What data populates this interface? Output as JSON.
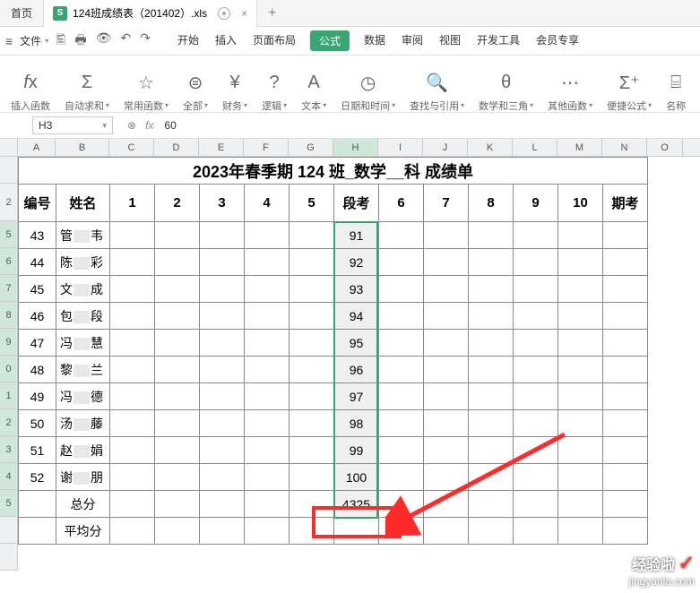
{
  "titlebar": {
    "home": "首页",
    "filename": "124班成绩表（201402）.xls",
    "plus": "+"
  },
  "menubar": {
    "file": "文件",
    "tabs": [
      "开始",
      "插入",
      "页面布局",
      "公式",
      "数据",
      "审阅",
      "视图",
      "开发工具",
      "会员专享"
    ]
  },
  "ribbon": {
    "items": [
      {
        "icon": "fx",
        "label": "插入函数"
      },
      {
        "icon": "Σ",
        "label": "自动求和"
      },
      {
        "icon": "☆",
        "label": "常用函数"
      },
      {
        "icon": "⊜",
        "label": "全部"
      },
      {
        "icon": "￥",
        "label": "财务"
      },
      {
        "icon": "?",
        "label": "逻辑"
      },
      {
        "icon": "A",
        "label": "文本"
      },
      {
        "icon": "⊙",
        "label": "日期和时间"
      },
      {
        "icon": "Q",
        "label": "查找与引用"
      },
      {
        "icon": "e",
        "label": "数学和三角"
      },
      {
        "icon": "…",
        "label": "其他函数"
      },
      {
        "icon": "Σ₊",
        "label": "便捷公式"
      },
      {
        "icon": "",
        "label": "名称"
      }
    ]
  },
  "formula_bar": {
    "name_box": "H3",
    "fx": "fx",
    "value": "60"
  },
  "columns": [
    "A",
    "B",
    "C",
    "D",
    "E",
    "F",
    "G",
    "H",
    "I",
    "J",
    "K",
    "L",
    "M",
    "N",
    "O"
  ],
  "row_numbers_visible": [
    "",
    "2",
    "5",
    "6",
    "7",
    "8",
    "9",
    "0",
    "1",
    "2",
    "3",
    "4",
    "5",
    "",
    ""
  ],
  "active_col": "H",
  "sheet": {
    "title": "2023年春季期 124 班_数学__科 成绩单",
    "headers": {
      "bianhao": "编号",
      "xingming": "姓名",
      "c1": "1",
      "c2": "2",
      "c3": "3",
      "c4": "4",
      "c5": "5",
      "duankao": "段考",
      "c6": "6",
      "c7": "7",
      "c8": "8",
      "c9": "9",
      "c10": "10",
      "qikao": "期考"
    },
    "rows": [
      {
        "id": "43",
        "name_first": "管",
        "name_last": "韦",
        "duankao": "91"
      },
      {
        "id": "44",
        "name_first": "陈",
        "name_last": "彩",
        "duankao": "92"
      },
      {
        "id": "45",
        "name_first": "文",
        "name_last": "成",
        "duankao": "93"
      },
      {
        "id": "46",
        "name_first": "包",
        "name_last": "段",
        "duankao": "94"
      },
      {
        "id": "47",
        "name_first": "冯",
        "name_last": "慧",
        "duankao": "95"
      },
      {
        "id": "48",
        "name_first": "黎",
        "name_last": "兰",
        "duankao": "96"
      },
      {
        "id": "49",
        "name_first": "冯",
        "name_last": "德",
        "duankao": "97"
      },
      {
        "id": "50",
        "name_first": "汤",
        "name_last": "藤",
        "duankao": "98"
      },
      {
        "id": "51",
        "name_first": "赵",
        "name_last": "娟",
        "duankao": "99"
      },
      {
        "id": "52",
        "name_first": "谢",
        "name_last": "朋",
        "duankao": "100"
      }
    ],
    "total_label": "总分",
    "total_value": "4325",
    "avg_label": "平均分"
  },
  "watermark": {
    "line1": "经验啦",
    "check": "✓",
    "line2": "jingyanla.com"
  }
}
